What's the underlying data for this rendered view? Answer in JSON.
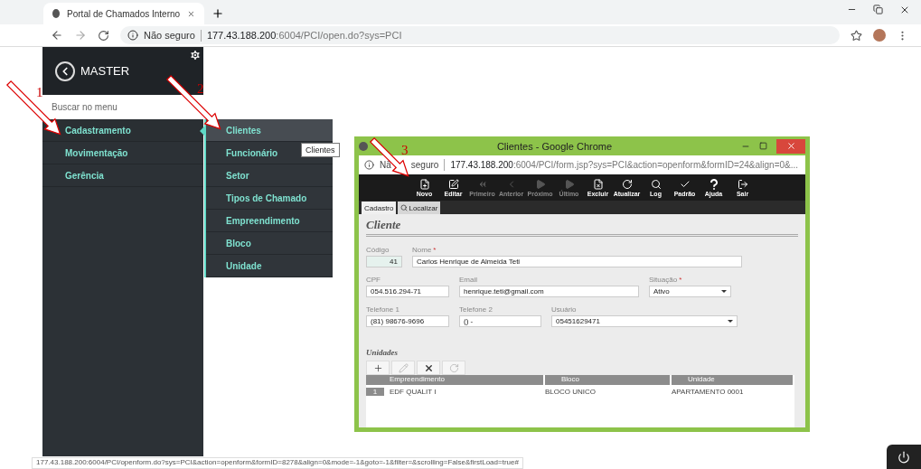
{
  "browser": {
    "tab_title": "Portal de Chamados Interno",
    "security": "Não seguro",
    "url_host": "177.43.188.200",
    "url_path": ":6004/PCI/open.do?sys=PCI"
  },
  "sidebar": {
    "title": "MASTER",
    "search": {
      "placeholder": "Buscar no menu"
    },
    "items": [
      {
        "label": "Cadastramento",
        "selected": true
      },
      {
        "label": "Movimentação",
        "selected": false
      },
      {
        "label": "Gerência",
        "selected": false
      }
    ]
  },
  "submenu": {
    "items": [
      {
        "label": "Clientes",
        "selected": true
      },
      {
        "label": "Funcionário",
        "selected": false
      },
      {
        "label": "Setor",
        "selected": false
      },
      {
        "label": "Tipos de Chamado",
        "selected": false
      },
      {
        "label": "Empreendimento",
        "selected": false
      },
      {
        "label": "Bloco",
        "selected": false
      },
      {
        "label": "Unidade",
        "selected": false
      }
    ]
  },
  "tooltip": "Clientes",
  "popup": {
    "title": "Clientes - Google Chrome",
    "security_parts": [
      "Nã",
      "seguro"
    ],
    "url_host": "177.43.188.200",
    "url_path": ":6004/PCI/form.jsp?sys=PCI&action=openform&formID=24&align=0&...",
    "toolbar": [
      {
        "label": "Novo",
        "disabled": false
      },
      {
        "label": "Editar",
        "disabled": false
      },
      {
        "label": "Primeiro",
        "disabled": true
      },
      {
        "label": "Anterior",
        "disabled": true
      },
      {
        "label": "Próximo",
        "disabled": true
      },
      {
        "label": "Último",
        "disabled": true
      },
      {
        "label": "Excluir",
        "disabled": false
      },
      {
        "label": "Atualizar",
        "disabled": false
      },
      {
        "label": "Log",
        "disabled": false
      },
      {
        "label": "Padrão",
        "disabled": false
      },
      {
        "label": "Ajuda",
        "disabled": false
      },
      {
        "label": "Sair",
        "disabled": false
      }
    ],
    "tabs": [
      {
        "label": "Cadastro",
        "selected": true
      },
      {
        "label": "Localizar",
        "selected": false
      }
    ],
    "section_title": "Cliente",
    "field_rows": [
      [
        {
          "label": "Código",
          "value": "41",
          "kind": "number"
        },
        {
          "label": "Nome",
          "required_mark": "*",
          "value": "Carlos Henrique de Almeida Teti",
          "kind": "text"
        }
      ],
      [
        {
          "label": "CPF",
          "value": "054.516.294-71",
          "kind": "text"
        },
        {
          "label": "Email",
          "value": "henrique.teti@gmail.com",
          "kind": "text"
        },
        {
          "label": "Situação",
          "required_mark": "*",
          "value": "Ativo",
          "kind": "select"
        }
      ],
      [
        {
          "label": "Telefone 1",
          "value": "(81) 98676-9696",
          "kind": "text"
        },
        {
          "label": "Telefone 2",
          "value": "() -",
          "kind": "text"
        },
        {
          "label": "Usuário",
          "value": "05451629471",
          "kind": "select"
        }
      ]
    ],
    "subsection_title": "Unidades",
    "grid_tools": [
      {
        "disabled": false
      },
      {
        "disabled": true
      },
      {
        "disabled": false
      },
      {
        "disabled": true
      }
    ],
    "grid": {
      "columns": [
        "Empreendimento",
        "Bloco",
        "Unidade"
      ],
      "rows": [
        {
          "number": "1",
          "cells": [
            "EDF QUALIT I",
            "BLOCO UNICO",
            "APARTAMENTO 0001"
          ]
        }
      ]
    }
  },
  "status_url": "177.43.188.200:6004/PCI/openform.do?sys=PCI&action=openform&formID=8278&align=0&mode=-1&goto=-1&filter=&scrolling=False&firstLoad=true#",
  "annotations": [
    {
      "label": "1"
    },
    {
      "label": "2"
    },
    {
      "label": "3"
    }
  ]
}
